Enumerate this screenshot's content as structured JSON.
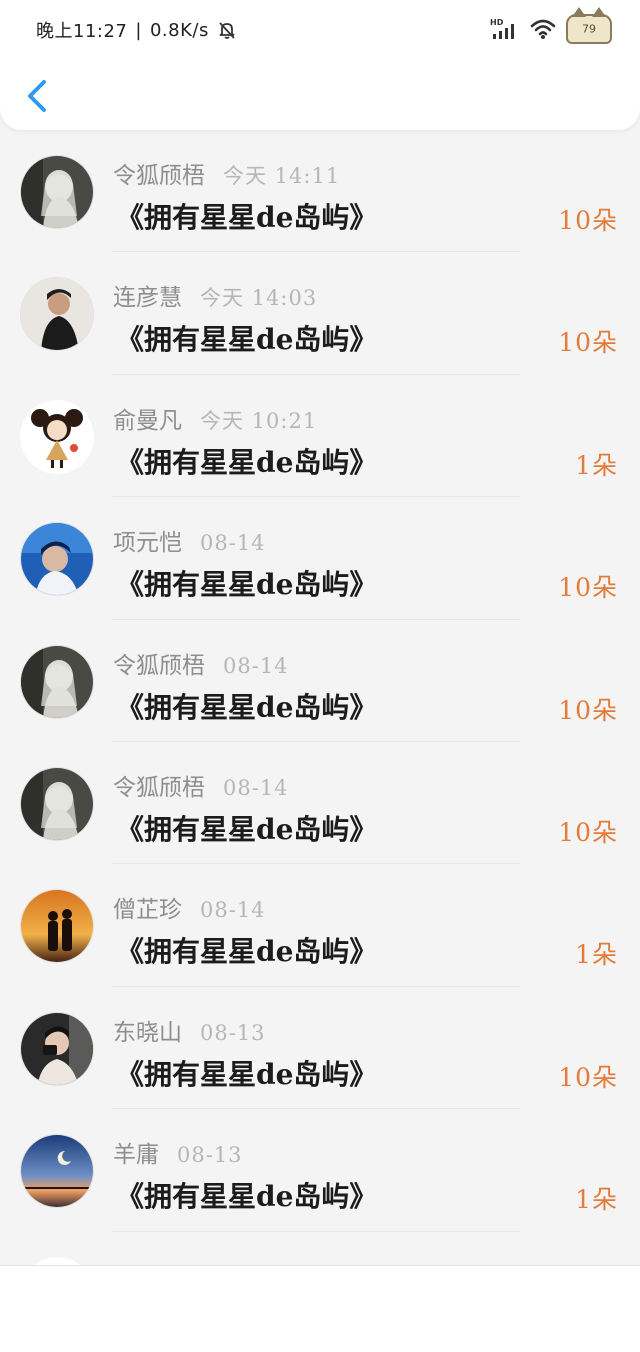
{
  "status_bar": {
    "time": "晚上11:27",
    "speed": "0.8K/s",
    "network_badge": "HD",
    "battery": "79"
  },
  "header": {
    "back_icon": "chevron-left-icon"
  },
  "colors": {
    "accent_blue": "#2e9bf0",
    "count_orange": "#e37b3a",
    "name_gray": "#8e8e8e",
    "time_gray": "#b6b6b6"
  },
  "records": [
    {
      "user": "令狐颀梧",
      "time": "今天 14:11",
      "gift": "《拥有星星de岛屿》",
      "count": "10朵",
      "avatar": "avatar-ghost-girl"
    },
    {
      "user": "连彦慧",
      "time": "今天 14:03",
      "gift": "《拥有星星de岛屿》",
      "count": "10朵",
      "avatar": "avatar-boy-wall"
    },
    {
      "user": "俞曼凡",
      "time": "今天 10:21",
      "gift": "《拥有星星de岛屿》",
      "count": "1朵",
      "avatar": "avatar-cartoon-girl"
    },
    {
      "user": "项元恺",
      "time": "08-14",
      "gift": "《拥有星星de岛屿》",
      "count": "10朵",
      "avatar": "avatar-blue-boy"
    },
    {
      "user": "令狐颀梧",
      "time": "08-14",
      "gift": "《拥有星星de岛屿》",
      "count": "10朵",
      "avatar": "avatar-ghost-girl"
    },
    {
      "user": "令狐颀梧",
      "time": "08-14",
      "gift": "《拥有星星de岛屿》",
      "count": "10朵",
      "avatar": "avatar-ghost-girl"
    },
    {
      "user": "僧芷珍",
      "time": "08-14",
      "gift": "《拥有星星de岛屿》",
      "count": "1朵",
      "avatar": "avatar-sunset-couple"
    },
    {
      "user": "东晓山",
      "time": "08-13",
      "gift": "《拥有星星de岛屿》",
      "count": "10朵",
      "avatar": "avatar-camera-boy"
    },
    {
      "user": "羊庸",
      "time": "08-13",
      "gift": "《拥有星星de岛屿》",
      "count": "1朵",
      "avatar": "avatar-moon-sea"
    },
    {
      "user": "",
      "time": "",
      "gift": "",
      "count": "",
      "avatar": "avatar-partial"
    }
  ]
}
